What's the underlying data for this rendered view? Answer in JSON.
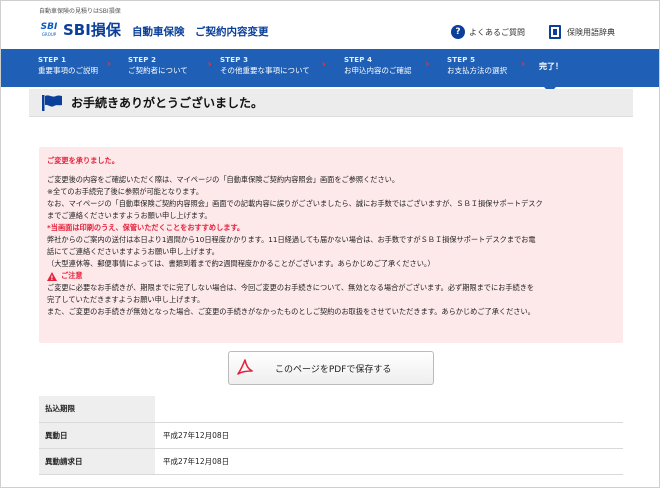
{
  "header": {
    "tagline": "自動車保険の見積りはSBI損保",
    "logo_mark": "SBI",
    "logo_group": "GROUP",
    "logo_text": "SBI損保",
    "page_heading": "自動車保険　ご契約内容変更",
    "faq_label": "よくあるご質問",
    "dict_label": "保険用語辞典"
  },
  "steps": [
    {
      "num": "STEP 1",
      "label": "重要事項のご説明"
    },
    {
      "num": "STEP 2",
      "label": "ご契約者について"
    },
    {
      "num": "STEP 3",
      "label": "その他重要な事項について"
    },
    {
      "num": "STEP 4",
      "label": "お申込内容のご確認"
    },
    {
      "num": "STEP 5",
      "label": "お支払方法の選択"
    },
    {
      "label": "完了！"
    }
  ],
  "page_title": "お手続きありがとうございました。",
  "message": {
    "heading": "ご変更を承りました。",
    "p1": "ご変更後の内容をご確認いただく際は、マイページの「自動車保険ご契約内容照会」画面をご参照ください。",
    "p2": "※全てのお手続完了後に参照が可能となります。",
    "p3a": "なお、マイページの「自動車保険ご契約内容照会」画面での記載内容に誤りがございましたら、誠にお手数ではございますが、ＳＢＩ損保サポートデスク",
    "p3b": "までご連絡くださいますようお願い申し上げます。",
    "print_note": "*当画面は印刷のうえ、保管いただくことをおすすめします。",
    "p4a": "弊社からのご案内の送付は本日より1週間から10日程度かかります。11日経過しても届かない場合は、お手数ですがＳＢＩ損保サポートデスクまでお電",
    "p4b": "話にてご連絡くださいますようお願い申し上げます。",
    "p5": "（大型連休等、郵便事情によっては、書類到着まで約2週間程度かかることがございます。あらかじめご了承ください。）",
    "caution_label": "ご注意",
    "c1a": "ご変更に必要なお手続きが、期限までに完了しない場合は、今回ご変更のお手続きについて、無効となる場合がございます。必ず期限までにお手続きを",
    "c1b": "完了していただきますようお願い申し上げます。",
    "c2": "また、ご変更のお手続きが無効となった場合、ご変更の手続きがなかったものとしご契約のお取扱をさせていただきます。あらかじめご了承ください。"
  },
  "pdf_button": {
    "label": "このページをPDFで保存する"
  },
  "table": [
    {
      "key": "払込期限",
      "value": ""
    },
    {
      "key": "異動日",
      "value": "平成27年12月08日"
    },
    {
      "key": "異動請求日",
      "value": "平成27年12月08日"
    }
  ],
  "colors": {
    "brand": "#0a3f9a",
    "stepbar": "#1f5fb5",
    "alert": "#e5233d",
    "message_bg": "#fde8ea"
  }
}
